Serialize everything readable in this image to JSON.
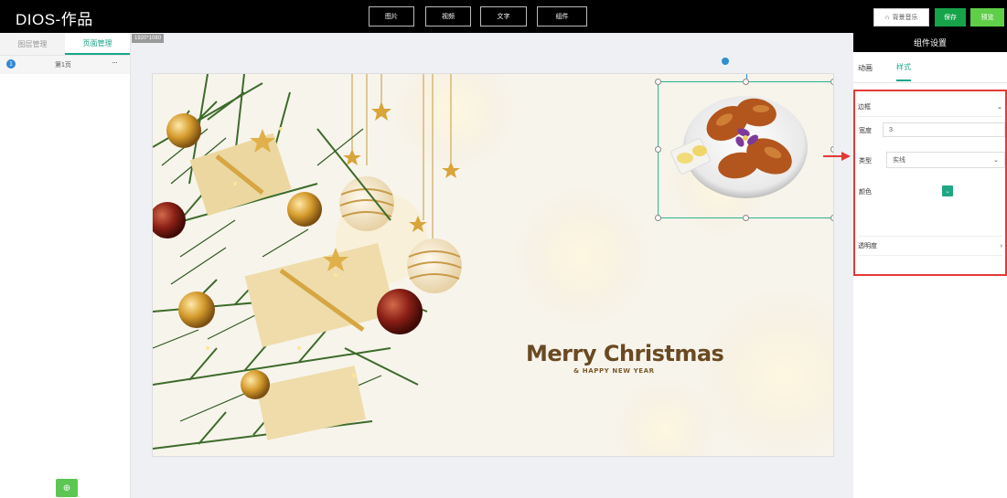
{
  "app": {
    "title": "DIOS-作品"
  },
  "toolbar": {
    "image": "图片",
    "video": "视频",
    "text": "文字",
    "component": "组件",
    "music": "背景音乐",
    "save": "保存",
    "preview": "预览"
  },
  "left_panel": {
    "tabs": [
      {
        "label": "图层管理"
      },
      {
        "label": "页面管理"
      }
    ],
    "pages": [
      {
        "index": "1",
        "name": "第1页",
        "more": "···"
      }
    ],
    "add_icon": "⊕"
  },
  "canvas": {
    "resolution": "1920*1080",
    "title": "Merry Christmas",
    "subtitle": "& HAPPY NEW YEAR"
  },
  "right_panel": {
    "header": "组件设置",
    "tabs": [
      {
        "label": "动画"
      },
      {
        "label": "样式"
      }
    ],
    "border_label": "边框",
    "width_label": "宽度",
    "width_value": "3",
    "type_label": "类型",
    "type_value": "实线",
    "color_label": "颜色",
    "opacity_label": "透明度"
  },
  "colors": {
    "accent": "#1aa58b",
    "highlight": "#e23a36",
    "save": "#16a34a",
    "preview": "#5fcf48"
  }
}
